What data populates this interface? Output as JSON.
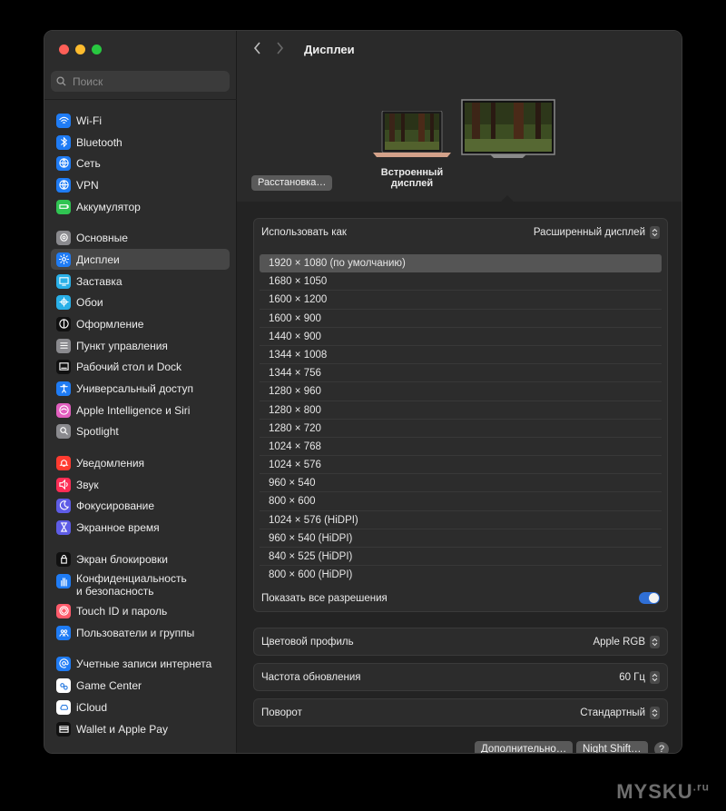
{
  "window": {
    "title": "Дисплеи"
  },
  "search": {
    "placeholder": "Поиск"
  },
  "sidebar": {
    "items": [
      {
        "label": "Wi-Fi",
        "icon": "wifi-icon",
        "color": "#1f7cf5"
      },
      {
        "label": "Bluetooth",
        "icon": "bluetooth-icon",
        "color": "#1f7cf5"
      },
      {
        "label": "Сеть",
        "icon": "globe-icon",
        "color": "#1f7cf5"
      },
      {
        "label": "VPN",
        "icon": "vpn-globe-icon",
        "color": "#1f7cf5"
      },
      {
        "label": "Аккумулятор",
        "icon": "battery-icon",
        "color": "#30c452"
      },
      {
        "label": "Основные",
        "icon": "gear-icon",
        "color": "#8a8a8e"
      },
      {
        "label": "Дисплеи",
        "icon": "sun-icon",
        "color": "#1f7cf5",
        "selected": true
      },
      {
        "label": "Заставка",
        "icon": "screensaver-icon",
        "color": "#29b0e8"
      },
      {
        "label": "Обои",
        "icon": "flower-icon",
        "color": "#29b0e8"
      },
      {
        "label": "Оформление",
        "icon": "appearance-icon",
        "color": "#111111"
      },
      {
        "label": "Пункт управления",
        "icon": "control-center-icon",
        "color": "#8a8a8e"
      },
      {
        "label": "Рабочий стол и Dock",
        "icon": "dock-icon",
        "color": "#111111"
      },
      {
        "label": "Универсальный доступ",
        "icon": "accessibility-icon",
        "color": "#1f7cf5"
      },
      {
        "label": "Apple Intelligence и Siri",
        "icon": "siri-icon",
        "color": "#e25fbf"
      },
      {
        "label": "Spotlight",
        "icon": "magnifier-icon",
        "color": "#8a8a8e"
      },
      {
        "label": "Уведомления",
        "icon": "bell-icon",
        "color": "#ff3b30"
      },
      {
        "label": "Звук",
        "icon": "speaker-icon",
        "color": "#ff2d55"
      },
      {
        "label": "Фокусирование",
        "icon": "moon-icon",
        "color": "#5e5ce6"
      },
      {
        "label": "Экранное время",
        "icon": "hourglass-icon",
        "color": "#5e5ce6"
      },
      {
        "label": "Экран блокировки",
        "icon": "lock-icon",
        "color": "#111111"
      },
      {
        "label": "Конфиденциальность\nи безопасность",
        "icon": "hand-icon",
        "color": "#1f7cf5"
      },
      {
        "label": "Touch ID и пароль",
        "icon": "fingerprint-icon",
        "color": "#ff5b6b"
      },
      {
        "label": "Пользователи и группы",
        "icon": "users-icon",
        "color": "#1f7cf5"
      },
      {
        "label": "Учетные записи интернета",
        "icon": "at-icon",
        "color": "#1f7cf5"
      },
      {
        "label": "Game Center",
        "icon": "game-center-icon",
        "color": "#ffffff"
      },
      {
        "label": "iCloud",
        "icon": "cloud-icon",
        "color": "#ffffff"
      },
      {
        "label": "Wallet и Apple Pay",
        "icon": "wallet-icon",
        "color": "#111111"
      }
    ]
  },
  "displays": {
    "builtin_caption": "Встроенный дисплей",
    "arrange_label": "Расстановка…"
  },
  "use_as": {
    "label": "Использовать как",
    "value": "Расширенный дисплей"
  },
  "resolutions": [
    "1920 × 1080 (по умолчанию)",
    "1680 × 1050",
    "1600 × 1200",
    "1600 × 900",
    "1440 × 900",
    "1344 × 1008",
    "1344 × 756",
    "1280 × 960",
    "1280 × 800",
    "1280 × 720",
    "1024 × 768",
    "1024 × 576",
    "960 × 540",
    "800 × 600",
    "1024 × 576 (HiDPI)",
    "960 × 540 (HiDPI)",
    "840 × 525 (HiDPI)",
    "800 × 600 (HiDPI)"
  ],
  "selected_resolution": "1920 × 1080 (по умолчанию)",
  "show_all": {
    "label": "Показать все разрешения",
    "enabled": true
  },
  "color_profile": {
    "label": "Цветовой профиль",
    "value": "Apple RGB"
  },
  "refresh_rate": {
    "label": "Частота обновления",
    "value": "60 Гц"
  },
  "rotation": {
    "label": "Поворот",
    "value": "Стандартный"
  },
  "footer": {
    "advanced_label": "Дополнительно…",
    "night_shift_label": "Night Shift…",
    "help_label": "?"
  },
  "watermark": {
    "text": "MYSKU",
    "suffix": ".ru"
  }
}
